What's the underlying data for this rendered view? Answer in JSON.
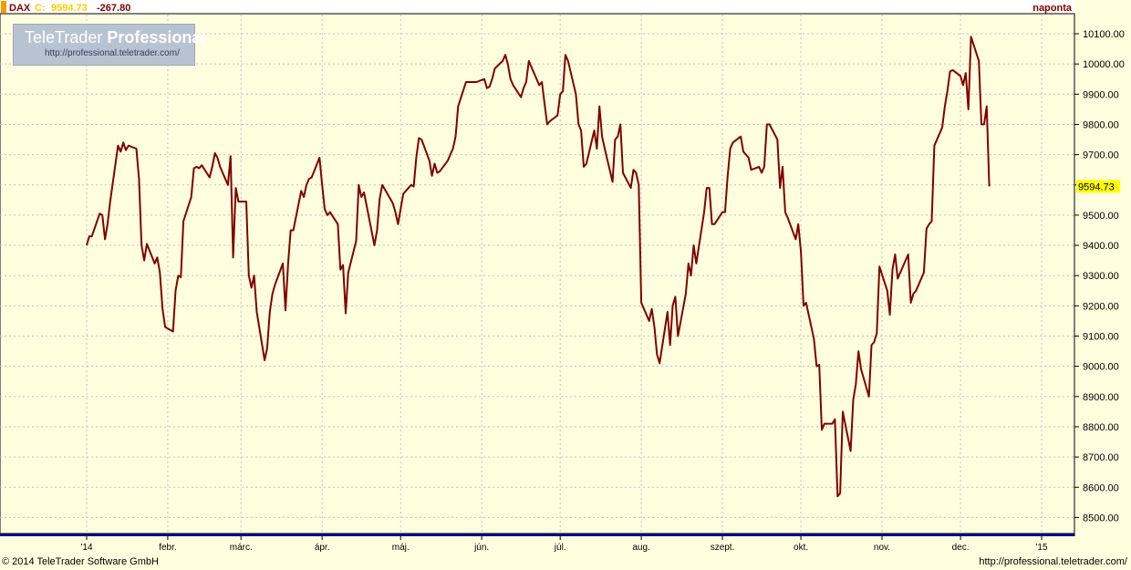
{
  "header": {
    "symbol": "DAX",
    "close_label": "C:",
    "close_value": "9594.73",
    "change": "-267.80",
    "period": "naponta"
  },
  "logo": {
    "title_regular": "TeleTrader ",
    "title_bold": "Professional",
    "url": "http://professional.teletrader.com/"
  },
  "footer": {
    "copyright": "© 2014 TeleTrader Software GmbH",
    "url": "http://professional.teletrader.com/"
  },
  "last_price_label": "9594.73",
  "colors": {
    "background": "#ffffe0",
    "line": "#800000",
    "grid": "#c0c0c0",
    "change_negative": "#800000",
    "close_highlight": "#ffff00"
  },
  "chart_data": {
    "type": "line",
    "ylim": [
      8450,
      10150
    ],
    "y_ticks": [
      10100,
      10000,
      9900,
      9800,
      9700,
      9600,
      9500,
      9400,
      9300,
      9200,
      9100,
      9000,
      8900,
      8800,
      8700,
      8600,
      8500
    ],
    "y_tick_labels": [
      "10100.00",
      "10000.00",
      "9900.00",
      "9800.00",
      "9700.00",
      "9600.00",
      "9500.00",
      "9400.00",
      "9300.00",
      "9200.00",
      "9100.00",
      "9000.00",
      "8900.00",
      "8800.00",
      "8700.00",
      "8600.00",
      "8500.00"
    ],
    "x_labels": [
      {
        "label": "'14",
        "date": "2014-01-01"
      },
      {
        "label": "febr.",
        "date": "2014-02-01"
      },
      {
        "label": "márc.",
        "date": "2014-03-01"
      },
      {
        "label": "ápr.",
        "date": "2014-04-01"
      },
      {
        "label": "máj.",
        "date": "2014-05-01"
      },
      {
        "label": "jún.",
        "date": "2014-06-01"
      },
      {
        "label": "júl.",
        "date": "2014-07-01"
      },
      {
        "label": "aug.",
        "date": "2014-08-01"
      },
      {
        "label": "szept.",
        "date": "2014-09-01"
      },
      {
        "label": "okt.",
        "date": "2014-10-01"
      },
      {
        "label": "nov.",
        "date": "2014-11-01"
      },
      {
        "label": "dec.",
        "date": "2014-12-01"
      },
      {
        "label": "'15",
        "date": "2015-01-01"
      }
    ],
    "xlim": [
      "2014-01-01",
      "2015-01-01"
    ],
    "series": [
      {
        "name": "DAX",
        "points": [
          [
            "2014-01-01",
            9400
          ],
          [
            "2014-01-02",
            9430
          ],
          [
            "2014-01-03",
            9430
          ],
          [
            "2014-01-06",
            9505
          ],
          [
            "2014-01-07",
            9500
          ],
          [
            "2014-01-08",
            9420
          ],
          [
            "2014-01-09",
            9470
          ],
          [
            "2014-01-10",
            9545
          ],
          [
            "2014-01-13",
            9730
          ],
          [
            "2014-01-14",
            9710
          ],
          [
            "2014-01-15",
            9740
          ],
          [
            "2014-01-16",
            9715
          ],
          [
            "2014-01-17",
            9730
          ],
          [
            "2014-01-20",
            9720
          ],
          [
            "2014-01-21",
            9620
          ],
          [
            "2014-01-22",
            9400
          ],
          [
            "2014-01-23",
            9350
          ],
          [
            "2014-01-24",
            9405
          ],
          [
            "2014-01-27",
            9340
          ],
          [
            "2014-01-28",
            9360
          ],
          [
            "2014-01-29",
            9310
          ],
          [
            "2014-01-30",
            9190
          ],
          [
            "2014-01-31",
            9130
          ],
          [
            "2014-02-03",
            9115
          ],
          [
            "2014-02-04",
            9250
          ],
          [
            "2014-02-05",
            9300
          ],
          [
            "2014-02-06",
            9295
          ],
          [
            "2014-02-07",
            9480
          ],
          [
            "2014-02-10",
            9560
          ],
          [
            "2014-02-11",
            9655
          ],
          [
            "2014-02-12",
            9660
          ],
          [
            "2014-02-13",
            9655
          ],
          [
            "2014-02-14",
            9665
          ],
          [
            "2014-02-17",
            9625
          ],
          [
            "2014-02-18",
            9660
          ],
          [
            "2014-02-19",
            9705
          ],
          [
            "2014-02-20",
            9690
          ],
          [
            "2014-02-21",
            9660
          ],
          [
            "2014-02-24",
            9600
          ],
          [
            "2014-02-25",
            9695
          ],
          [
            "2014-02-26",
            9360
          ],
          [
            "2014-02-27",
            9590
          ],
          [
            "2014-02-28",
            9545
          ],
          [
            "2014-03-03",
            9545
          ],
          [
            "2014-03-04",
            9300
          ],
          [
            "2014-03-05",
            9260
          ],
          [
            "2014-03-06",
            9300
          ],
          [
            "2014-03-07",
            9180
          ],
          [
            "2014-03-10",
            9020
          ],
          [
            "2014-03-11",
            9060
          ],
          [
            "2014-03-12",
            9180
          ],
          [
            "2014-03-13",
            9240
          ],
          [
            "2014-03-14",
            9270
          ],
          [
            "2014-03-17",
            9340
          ],
          [
            "2014-03-18",
            9185
          ],
          [
            "2014-03-19",
            9340
          ],
          [
            "2014-03-20",
            9450
          ],
          [
            "2014-03-21",
            9450
          ],
          [
            "2014-03-24",
            9580
          ],
          [
            "2014-03-25",
            9560
          ],
          [
            "2014-03-26",
            9600
          ],
          [
            "2014-03-27",
            9620
          ],
          [
            "2014-03-28",
            9625
          ],
          [
            "2014-03-31",
            9690
          ],
          [
            "2014-04-01",
            9600
          ],
          [
            "2014-04-02",
            9520
          ],
          [
            "2014-04-03",
            9500
          ],
          [
            "2014-04-04",
            9510
          ],
          [
            "2014-04-07",
            9470
          ],
          [
            "2014-04-08",
            9320
          ],
          [
            "2014-04-09",
            9335
          ],
          [
            "2014-04-10",
            9175
          ],
          [
            "2014-04-11",
            9310
          ],
          [
            "2014-04-14",
            9415
          ],
          [
            "2014-04-15",
            9600
          ],
          [
            "2014-04-16",
            9560
          ],
          [
            "2014-04-17",
            9575
          ],
          [
            "2014-04-21",
            9400
          ],
          [
            "2014-04-22",
            9450
          ],
          [
            "2014-04-23",
            9555
          ],
          [
            "2014-04-24",
            9600
          ],
          [
            "2014-04-25",
            9585
          ],
          [
            "2014-04-28",
            9540
          ],
          [
            "2014-04-29",
            9510
          ],
          [
            "2014-04-30",
            9470
          ],
          [
            "2014-05-02",
            9570
          ],
          [
            "2014-05-05",
            9600
          ],
          [
            "2014-05-06",
            9595
          ],
          [
            "2014-05-07",
            9690
          ],
          [
            "2014-05-08",
            9755
          ],
          [
            "2014-05-09",
            9750
          ],
          [
            "2014-05-12",
            9680
          ],
          [
            "2014-05-13",
            9630
          ],
          [
            "2014-05-14",
            9670
          ],
          [
            "2014-05-15",
            9640
          ],
          [
            "2014-05-16",
            9645
          ],
          [
            "2014-05-19",
            9680
          ],
          [
            "2014-05-20",
            9700
          ],
          [
            "2014-05-21",
            9720
          ],
          [
            "2014-05-22",
            9760
          ],
          [
            "2014-05-23",
            9860
          ],
          [
            "2014-05-26",
            9940
          ],
          [
            "2014-05-27",
            9940
          ],
          [
            "2014-05-28",
            9940
          ],
          [
            "2014-05-30",
            9940
          ],
          [
            "2014-06-02",
            9950
          ],
          [
            "2014-06-03",
            9920
          ],
          [
            "2014-06-04",
            9925
          ],
          [
            "2014-06-05",
            9950
          ],
          [
            "2014-06-06",
            9985
          ],
          [
            "2014-06-09",
            10010
          ],
          [
            "2014-06-10",
            10030
          ],
          [
            "2014-06-11",
            10000
          ],
          [
            "2014-06-12",
            9950
          ],
          [
            "2014-06-13",
            9930
          ],
          [
            "2014-06-16",
            9890
          ],
          [
            "2014-06-17",
            9920
          ],
          [
            "2014-06-18",
            9940
          ],
          [
            "2014-06-19",
            10010
          ],
          [
            "2014-06-20",
            9990
          ],
          [
            "2014-06-23",
            9930
          ],
          [
            "2014-06-24",
            9940
          ],
          [
            "2014-06-25",
            9870
          ],
          [
            "2014-06-26",
            9800
          ],
          [
            "2014-06-27",
            9810
          ],
          [
            "2014-06-30",
            9830
          ],
          [
            "2014-07-01",
            9900
          ],
          [
            "2014-07-02",
            9910
          ],
          [
            "2014-07-03",
            10030
          ],
          [
            "2014-07-04",
            10010
          ],
          [
            "2014-07-07",
            9900
          ],
          [
            "2014-07-08",
            9800
          ],
          [
            "2014-07-09",
            9780
          ],
          [
            "2014-07-10",
            9660
          ],
          [
            "2014-07-11",
            9670
          ],
          [
            "2014-07-14",
            9780
          ],
          [
            "2014-07-15",
            9720
          ],
          [
            "2014-07-16",
            9860
          ],
          [
            "2014-07-17",
            9760
          ],
          [
            "2014-07-18",
            9720
          ],
          [
            "2014-07-21",
            9610
          ],
          [
            "2014-07-22",
            9750
          ],
          [
            "2014-07-23",
            9760
          ],
          [
            "2014-07-24",
            9800
          ],
          [
            "2014-07-25",
            9640
          ],
          [
            "2014-07-28",
            9590
          ],
          [
            "2014-07-29",
            9650
          ],
          [
            "2014-07-30",
            9640
          ],
          [
            "2014-07-31",
            9600
          ],
          [
            "2014-08-01",
            9210
          ],
          [
            "2014-08-04",
            9150
          ],
          [
            "2014-08-05",
            9190
          ],
          [
            "2014-08-06",
            9130
          ],
          [
            "2014-08-07",
            9040
          ],
          [
            "2014-08-08",
            9010
          ],
          [
            "2014-08-11",
            9180
          ],
          [
            "2014-08-12",
            9070
          ],
          [
            "2014-08-13",
            9200
          ],
          [
            "2014-08-14",
            9230
          ],
          [
            "2014-08-15",
            9100
          ],
          [
            "2014-08-18",
            9240
          ],
          [
            "2014-08-19",
            9340
          ],
          [
            "2014-08-20",
            9300
          ],
          [
            "2014-08-21",
            9400
          ],
          [
            "2014-08-22",
            9340
          ],
          [
            "2014-08-25",
            9510
          ],
          [
            "2014-08-26",
            9590
          ],
          [
            "2014-08-27",
            9590
          ],
          [
            "2014-08-28",
            9470
          ],
          [
            "2014-08-29",
            9470
          ],
          [
            "2014-09-01",
            9510
          ],
          [
            "2014-09-02",
            9510
          ],
          [
            "2014-09-03",
            9630
          ],
          [
            "2014-09-04",
            9720
          ],
          [
            "2014-09-05",
            9740
          ],
          [
            "2014-09-08",
            9760
          ],
          [
            "2014-09-09",
            9710
          ],
          [
            "2014-09-10",
            9700
          ],
          [
            "2014-09-11",
            9690
          ],
          [
            "2014-09-12",
            9650
          ],
          [
            "2014-09-15",
            9660
          ],
          [
            "2014-09-16",
            9640
          ],
          [
            "2014-09-17",
            9660
          ],
          [
            "2014-09-18",
            9800
          ],
          [
            "2014-09-19",
            9800
          ],
          [
            "2014-09-22",
            9750
          ],
          [
            "2014-09-23",
            9590
          ],
          [
            "2014-09-24",
            9660
          ],
          [
            "2014-09-25",
            9510
          ],
          [
            "2014-09-26",
            9490
          ],
          [
            "2014-09-29",
            9420
          ],
          [
            "2014-09-30",
            9470
          ],
          [
            "2014-10-01",
            9380
          ],
          [
            "2014-10-02",
            9200
          ],
          [
            "2014-10-03",
            9210
          ],
          [
            "2014-10-06",
            9090
          ],
          [
            "2014-10-07",
            9000
          ],
          [
            "2014-10-08",
            9005
          ],
          [
            "2014-10-09",
            8790
          ],
          [
            "2014-10-10",
            8810
          ],
          [
            "2014-10-13",
            8810
          ],
          [
            "2014-10-14",
            8825
          ],
          [
            "2014-10-15",
            8570
          ],
          [
            "2014-10-16",
            8580
          ],
          [
            "2014-10-17",
            8850
          ],
          [
            "2014-10-20",
            8720
          ],
          [
            "2014-10-21",
            8890
          ],
          [
            "2014-10-22",
            8940
          ],
          [
            "2014-10-23",
            9050
          ],
          [
            "2014-10-24",
            8990
          ],
          [
            "2014-10-27",
            8900
          ],
          [
            "2014-10-28",
            9070
          ],
          [
            "2014-10-29",
            9080
          ],
          [
            "2014-10-30",
            9110
          ],
          [
            "2014-10-31",
            9330
          ],
          [
            "2014-11-03",
            9250
          ],
          [
            "2014-11-04",
            9170
          ],
          [
            "2014-11-05",
            9320
          ],
          [
            "2014-11-06",
            9370
          ],
          [
            "2014-11-07",
            9290
          ],
          [
            "2014-11-10",
            9350
          ],
          [
            "2014-11-11",
            9370
          ],
          [
            "2014-11-12",
            9210
          ],
          [
            "2014-11-13",
            9240
          ],
          [
            "2014-11-14",
            9250
          ],
          [
            "2014-11-17",
            9310
          ],
          [
            "2014-11-18",
            9455
          ],
          [
            "2014-11-19",
            9470
          ],
          [
            "2014-11-20",
            9480
          ],
          [
            "2014-11-21",
            9730
          ],
          [
            "2014-11-24",
            9790
          ],
          [
            "2014-11-25",
            9860
          ],
          [
            "2014-11-26",
            9910
          ],
          [
            "2014-11-27",
            9975
          ],
          [
            "2014-11-28",
            9980
          ],
          [
            "2014-12-01",
            9960
          ],
          [
            "2014-12-02",
            9930
          ],
          [
            "2014-12-03",
            9970
          ],
          [
            "2014-12-04",
            9850
          ],
          [
            "2014-12-05",
            10090
          ],
          [
            "2014-12-08",
            10010
          ],
          [
            "2014-12-09",
            9800
          ],
          [
            "2014-12-10",
            9800
          ],
          [
            "2014-12-11",
            9860
          ],
          [
            "2014-12-12",
            9595
          ]
        ]
      }
    ]
  }
}
